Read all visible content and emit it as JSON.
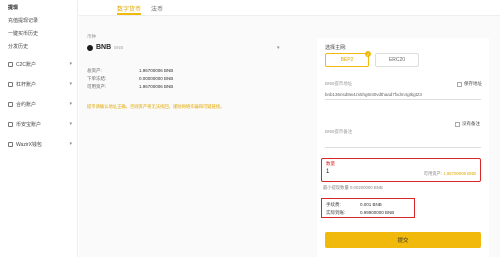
{
  "sidebar": {
    "items": [
      {
        "label": "提现",
        "active": true
      },
      {
        "label": "充值提现记录",
        "active": false
      },
      {
        "label": "一键买币历史",
        "active": false
      },
      {
        "label": "分发历史",
        "active": false
      },
      {
        "label": "C2C账户",
        "active": false,
        "chevron": "▾"
      },
      {
        "label": "杠杆账户",
        "active": false,
        "chevron": "▾"
      },
      {
        "label": "合约账户",
        "active": false,
        "chevron": "▾"
      },
      {
        "label": "币安宝账户",
        "active": false,
        "chevron": "▾"
      },
      {
        "label": "WazirX钱包",
        "active": false,
        "chevron": "▾"
      }
    ]
  },
  "tabs": [
    {
      "label": "数字货币",
      "active": true
    },
    {
      "label": "法币",
      "active": false
    }
  ],
  "left": {
    "coin_section_label": "币种",
    "coin_name": "BNB",
    "coin_sub": "BNB",
    "balances": [
      {
        "label": "总资产:",
        "value": "1.96700006 BNB"
      },
      {
        "label": "下单冻结:",
        "value": "0.00000000 BNB"
      },
      {
        "label": "可用资产:",
        "value": "1.96700006 BNB"
      }
    ],
    "notice": "提币请确认地址正确，否则资产将无法找回，谨防网络诈骗和可疑链接。"
  },
  "right": {
    "network_label": "选择主网:",
    "networks": [
      {
        "label": "BEP2",
        "active": true
      },
      {
        "label": "ERC20",
        "active": false
      }
    ],
    "address_label": "BNB提币地址",
    "save_address_label": "保存地址",
    "address_value": "bnb136nsd8w4zs5hg6nt0vdthaad7fxdm4gtkgt23",
    "memo_label": "BNB提币备注",
    "no_memo_label": "没有备注",
    "memo_value": "",
    "amount_label": "数量",
    "amount_value": "1",
    "available_label": "可用资产:",
    "available_value": "1.96700006 BNB",
    "min_withdraw": "最小提现数量 0.00200000 BNB",
    "fee_label": "手续费:",
    "fee_value": "0.001 BNB",
    "received_label": "实际到账:",
    "received_value": "0.99900000 BNB",
    "submit_label": "提交"
  },
  "colors": {
    "accent": "#f0b90b",
    "highlight": "#d92626"
  }
}
